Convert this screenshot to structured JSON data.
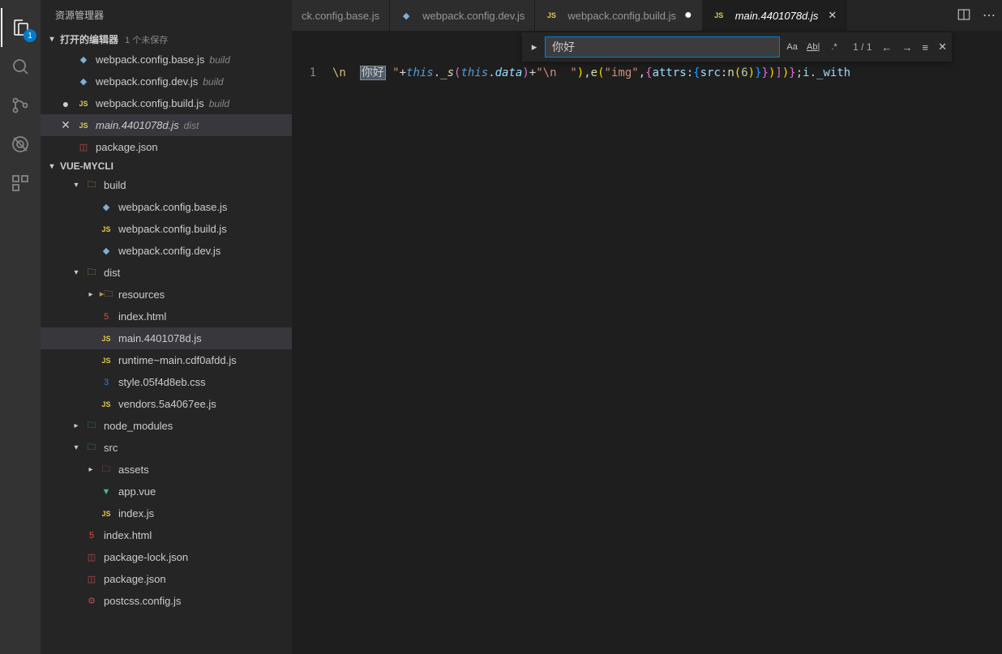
{
  "activityBar": {
    "badge": "1"
  },
  "sidebar": {
    "title": "资源管理器",
    "openEditors": {
      "header": "打开的编辑器",
      "status": "1 个未保存",
      "items": [
        {
          "label": "webpack.config.base.js",
          "sub": "build",
          "icon": "vue",
          "marker": ""
        },
        {
          "label": "webpack.config.dev.js",
          "sub": "build",
          "icon": "vue",
          "marker": ""
        },
        {
          "label": "webpack.config.build.js",
          "sub": "build",
          "icon": "js",
          "marker": "●"
        },
        {
          "label": "main.4401078d.js",
          "sub": "dist",
          "icon": "js",
          "marker": "✕",
          "italic": true,
          "selected": true
        }
      ]
    },
    "project": {
      "header": "VUE-MYCLI",
      "tree": [
        {
          "label": "build",
          "icon": "folder",
          "indent": 1,
          "chev": "▾"
        },
        {
          "label": "webpack.config.base.js",
          "icon": "vue",
          "indent": 2
        },
        {
          "label": "webpack.config.build.js",
          "icon": "js",
          "indent": 2
        },
        {
          "label": "webpack.config.dev.js",
          "icon": "vue",
          "indent": 2
        },
        {
          "label": "dist",
          "icon": "folder",
          "indent": 1,
          "chev": "▾"
        },
        {
          "label": "resources",
          "icon": "folder-dark",
          "indent": 2,
          "chev": "▸"
        },
        {
          "label": "index.html",
          "icon": "html",
          "indent": 2
        },
        {
          "label": "main.4401078d.js",
          "icon": "js",
          "indent": 2,
          "selected": true
        },
        {
          "label": "runtime~main.cdf0afdd.js",
          "icon": "js",
          "indent": 2
        },
        {
          "label": "style.05f4d8eb.css",
          "icon": "css",
          "indent": 2
        },
        {
          "label": "vendors.5a4067ee.js",
          "icon": "js",
          "indent": 2
        },
        {
          "label": "node_modules",
          "icon": "folder-green",
          "indent": 1,
          "chev": "▸"
        },
        {
          "label": "src",
          "icon": "folder-green",
          "indent": 1,
          "chev": "▾"
        },
        {
          "label": "assets",
          "icon": "folder-red",
          "indent": 2,
          "chev": "▸"
        },
        {
          "label": "app.vue",
          "icon": "vuelogo",
          "indent": 2
        },
        {
          "label": "index.js",
          "icon": "js",
          "indent": 2
        },
        {
          "label": "index.html",
          "icon": "html",
          "indent": 1
        },
        {
          "label": "package-lock.json",
          "icon": "json",
          "indent": 1
        },
        {
          "label": "package.json",
          "icon": "json",
          "indent": 1
        },
        {
          "label": "postcss.config.js",
          "icon": "gear",
          "indent": 1
        }
      ],
      "extras": [
        {
          "label": "package.json",
          "icon": "json"
        }
      ]
    }
  },
  "tabs": [
    {
      "label": "ck.config.base.js",
      "icon": "none",
      "truncated": true
    },
    {
      "label": "webpack.config.dev.js",
      "icon": "vue"
    },
    {
      "label": "webpack.config.build.js",
      "icon": "js",
      "dirty": true
    },
    {
      "label": "main.4401078d.js",
      "icon": "js",
      "italic": true,
      "active": true,
      "close": true
    }
  ],
  "find": {
    "value": "你好",
    "count": "1 / 1"
  },
  "editor": {
    "lineNumber": "1",
    "line": {
      "pre": "\\n  ",
      "hl": "你好",
      "post1": " \"",
      "plus1": "+",
      "this1": "this",
      "dot1": ".",
      "s1": "_s",
      "lp1": "(",
      "this2": "this",
      "dot2": ".",
      "data": "data",
      "rp1": ")",
      "plus2": "+",
      "str2": "\"\\n  \"",
      "rp2": ")",
      "com1": ",",
      "e": "e",
      "lp2": "(",
      "img": "\"img\"",
      "com2": ",",
      "lb1": "{",
      "attrs": "attrs",
      "col1": ":",
      "lb2": "{",
      "src": "src",
      "col2": ":",
      "n": "n",
      "lp3": "(",
      "num": "6",
      "rp3": ")",
      "rb2": "}",
      "rb1": "}",
      "rp4": ")",
      "rbr": "]",
      "rpr": ")",
      "rbf": "}",
      "sc": ";",
      "i": "i",
      "dot3": ".",
      "with": "_with"
    }
  }
}
